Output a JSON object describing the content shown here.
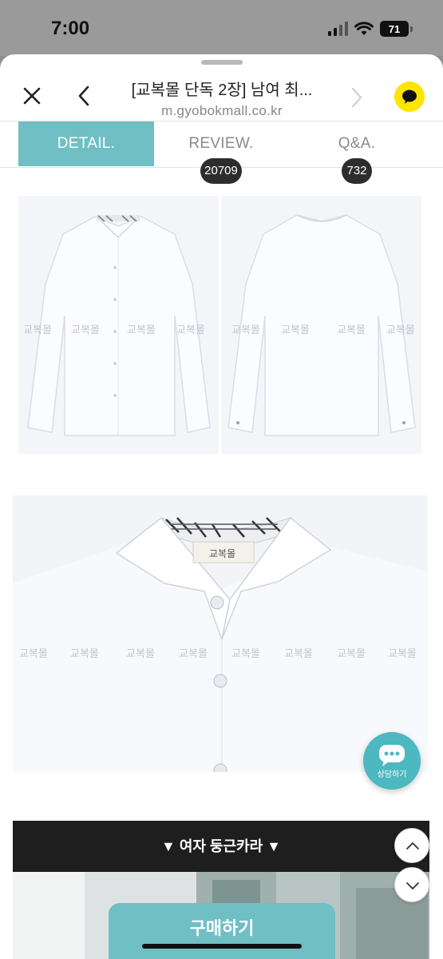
{
  "status_bar": {
    "time": "7:00",
    "battery": "71"
  },
  "browser": {
    "title": "[교복몰 단독 2장] 남여 최...",
    "url": "m.gyobokmall.co.kr"
  },
  "tabs": [
    {
      "label": "DETAIL."
    },
    {
      "label": "REVIEW.",
      "count": "20709"
    },
    {
      "label": "Q&A.",
      "count": "732"
    }
  ],
  "watermark": "교복몰",
  "collar_tag": "교복몰",
  "section_banner": "▼ 여자 둥근카라 ▼",
  "chat_button": {
    "label": "상담하기"
  },
  "buy_button": {
    "label": "구매하기"
  },
  "colors": {
    "accent": "#6fbfc5",
    "kakao": "#fee500",
    "chat": "#4db8c0",
    "banner": "#1e1e1e"
  }
}
